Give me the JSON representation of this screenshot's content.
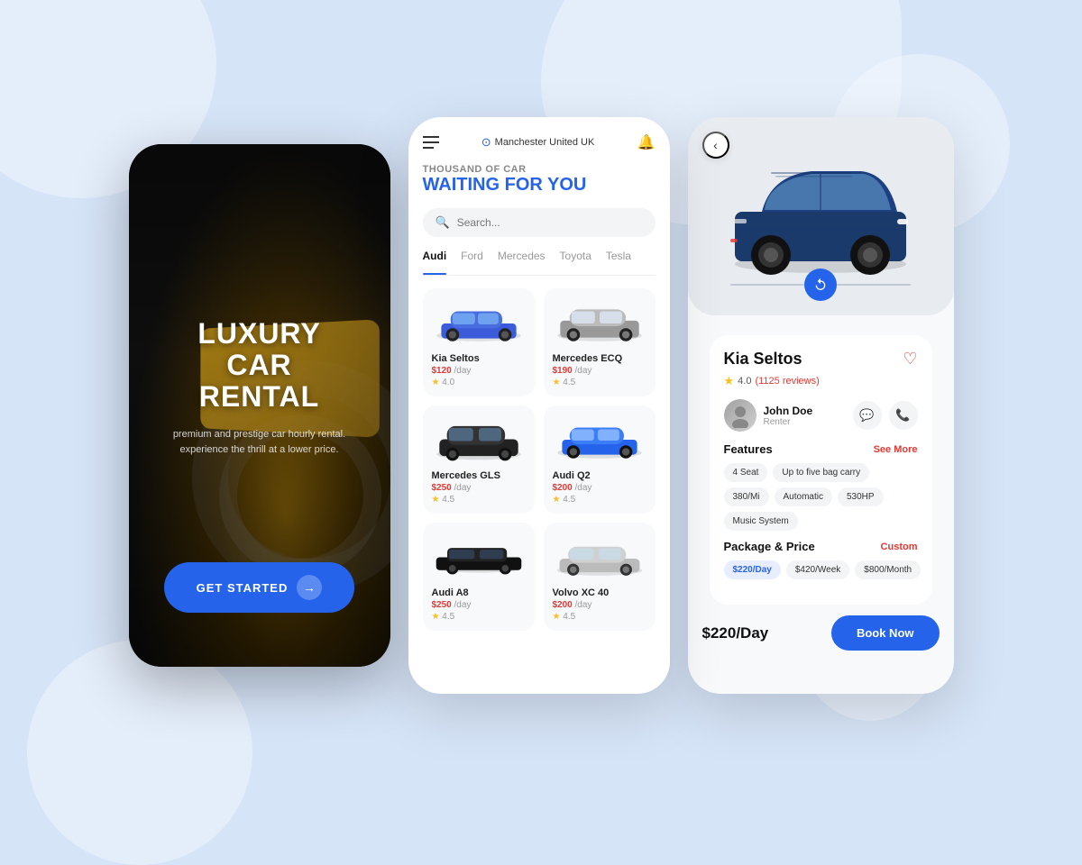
{
  "background": {
    "color": "#d6e4f7"
  },
  "screen1": {
    "title_line1": "LUXURY",
    "title_line2": "CAR",
    "title_line3": "RENTAL",
    "subtitle": "premium and prestige car hourly rental.\nexperience the thrill at a lower price.",
    "cta_label": "GET STARTED"
  },
  "screen2": {
    "location": "Manchester United UK",
    "heading_sub": "THOUSAND OF CAR",
    "heading_main": "WAITING FOR YOU",
    "search_placeholder": "Search...",
    "filters": [
      "Audi",
      "Ford",
      "Mercedes",
      "Toyota",
      "Tesla"
    ],
    "active_filter": "Audi",
    "cars": [
      {
        "name": "Kia Seltos",
        "price": "$120",
        "period": "/day",
        "rating": "4.0",
        "color": "#3b5bdb"
      },
      {
        "name": "Mercedes ECQ",
        "price": "$190",
        "period": "/day",
        "rating": "4.5",
        "color": "#888"
      },
      {
        "name": "Mercedes GLS",
        "price": "$250",
        "period": "/day",
        "rating": "4.5",
        "color": "#222"
      },
      {
        "name": "Audi Q2",
        "price": "$200",
        "period": "/day",
        "rating": "4.5",
        "color": "#2563eb"
      },
      {
        "name": "Audi A8",
        "price": "$250",
        "period": "/day",
        "rating": "4.5",
        "color": "#111"
      },
      {
        "name": "Volvo XC 40",
        "price": "$200",
        "period": "/day",
        "rating": "4.5",
        "color": "#aaa"
      }
    ]
  },
  "screen3": {
    "car_name": "Kia Seltos",
    "rating_value": "4.0",
    "rating_count": "1125 reviews",
    "renter_name": "John Doe",
    "renter_role": "Renter",
    "features_label": "Features",
    "see_more_label": "See More",
    "features": [
      "4 Seat",
      "Up to five bag carry",
      "380/Mi",
      "Automatic",
      "530HP",
      "Music System"
    ],
    "package_label": "Package & Price",
    "custom_label": "Custom",
    "packages": [
      "$220/Day",
      "$420/Week",
      "$800/Month"
    ],
    "current_price": "$220/Day",
    "book_label": "Book Now",
    "back_label": "‹"
  }
}
